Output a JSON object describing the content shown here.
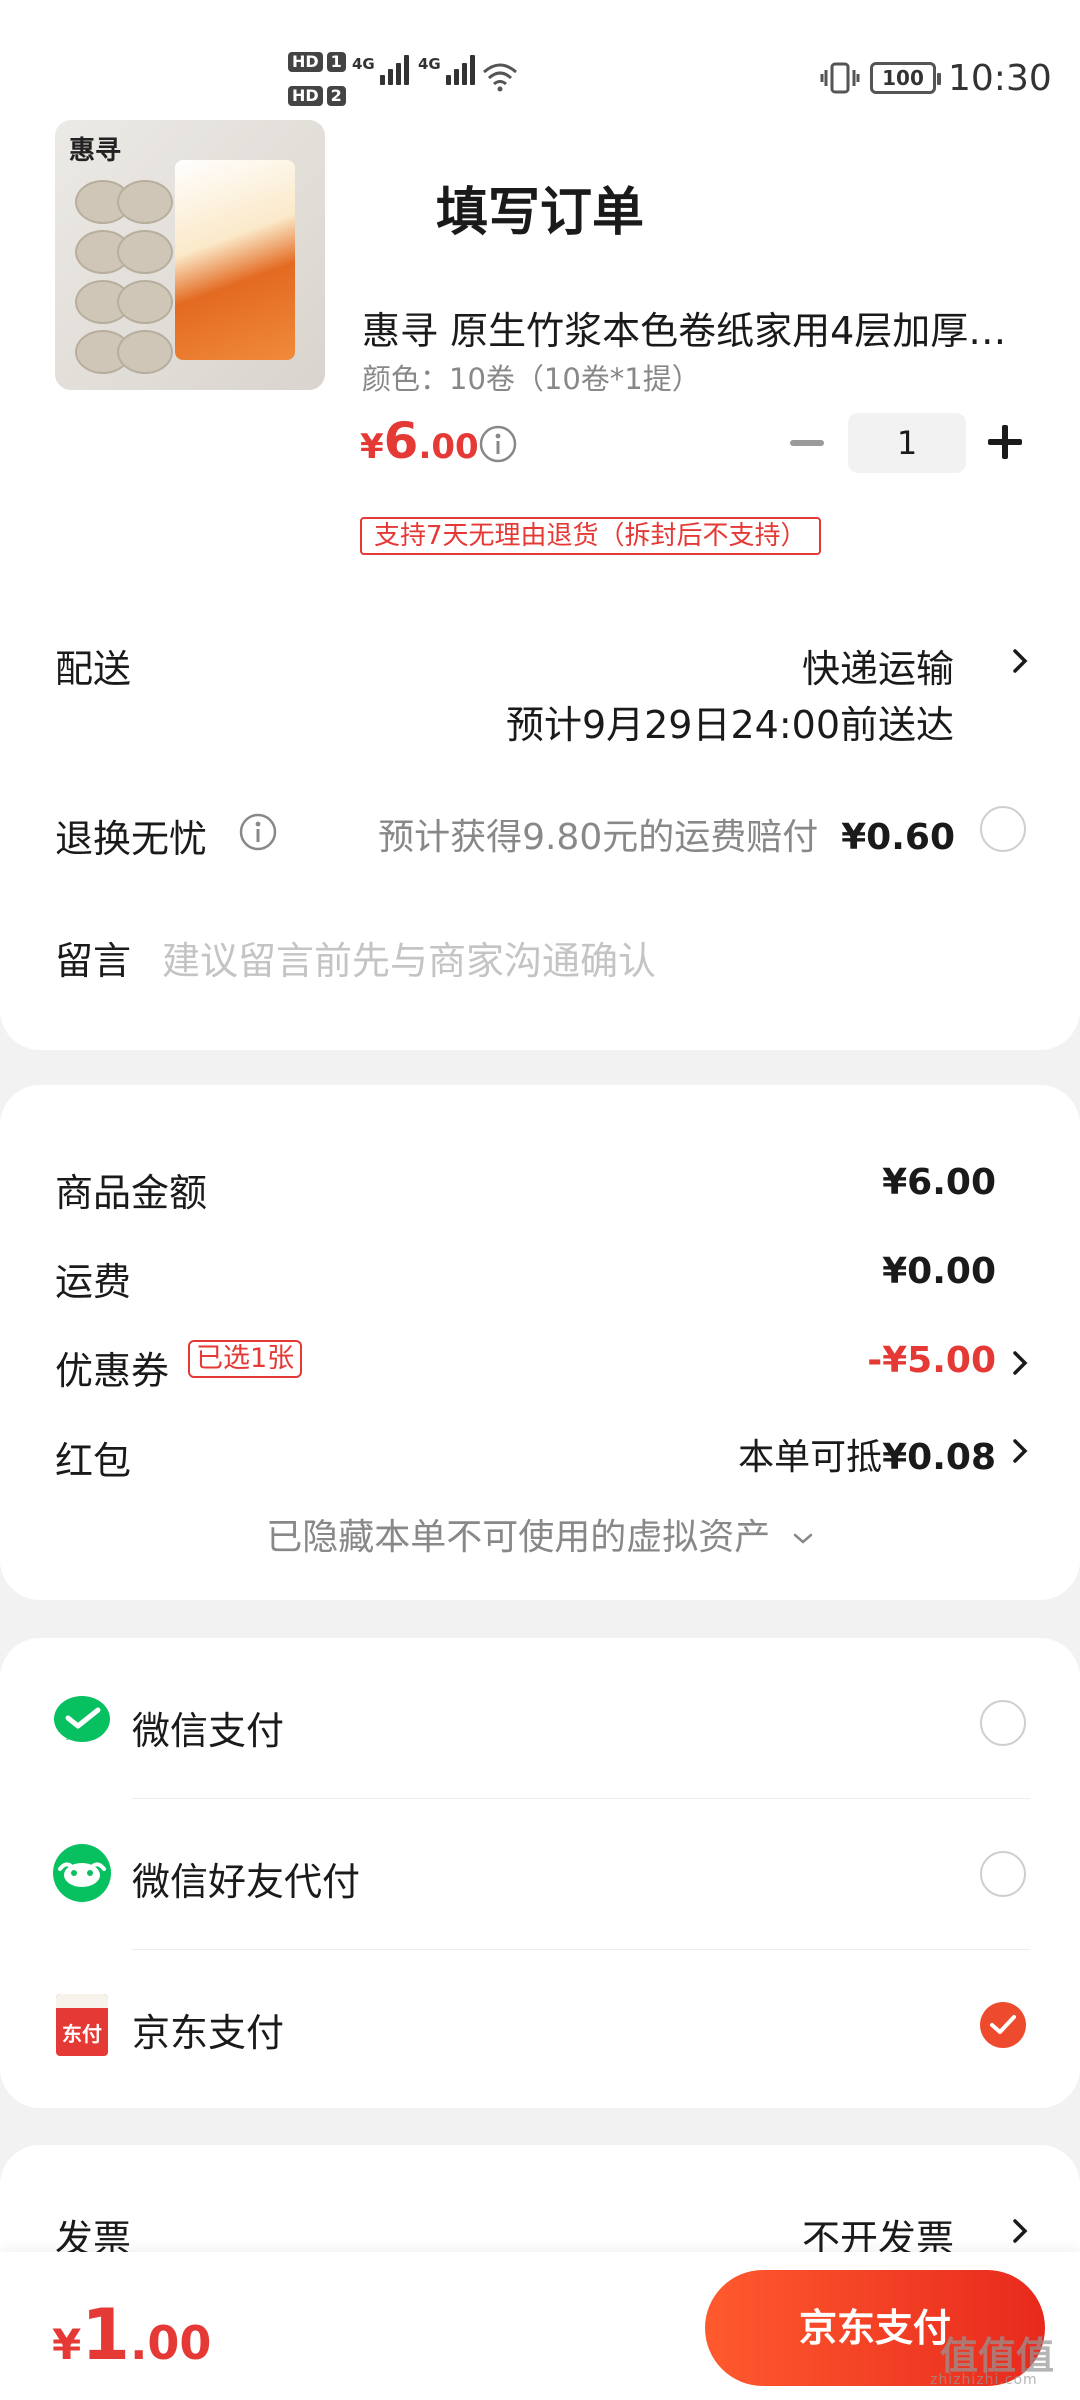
{
  "status_bar": {
    "hd1": "HD",
    "hd1_num": "1",
    "hd2": "HD",
    "hd2_num": "2",
    "net1": "4G",
    "net2": "4G",
    "battery": "100",
    "time": "10:30"
  },
  "nav": {
    "title": "填写订单",
    "back_icon": "back-chevron-icon"
  },
  "product": {
    "title": "惠寻 原生竹浆本色卷纸家用4层加厚…",
    "spec": "颜色：10卷（10卷*1提）",
    "price_currency": "¥",
    "price_int": "6",
    "price_dec": ".00",
    "quantity": "1",
    "return_policy": "支持7天无理由退货（拆封后不支持）",
    "thumb_brand": "惠寻"
  },
  "delivery": {
    "label": "配送",
    "method": "快递运输",
    "eta": "预计9月29日24:00前送达"
  },
  "return_insurance": {
    "label": "退换无忧",
    "desc": "预计获得9.80元的运费赔付",
    "price": "¥0.60",
    "checked": false
  },
  "remark": {
    "label": "留言",
    "placeholder": "建议留言前先与商家沟通确认"
  },
  "summary": {
    "goods_label": "商品金额",
    "goods_amount": "¥6.00",
    "freight_label": "运费",
    "freight_amount": "¥0.00",
    "coupon_label": "优惠券",
    "coupon_badge": "已选1张",
    "coupon_amount": "-¥5.00",
    "redpacket_label": "红包",
    "redpacket_prefix": "本单可抵",
    "redpacket_amount": "¥0.08",
    "hidden_assets": "已隐藏本单不可使用的虚拟资产"
  },
  "payment_methods": [
    {
      "label": "微信支付",
      "icon": "wechat-pay-icon",
      "selected": false
    },
    {
      "label": "微信好友代付",
      "icon": "wechat-friend-pay-icon",
      "selected": false
    },
    {
      "label": "京东支付",
      "icon": "jd-pay-icon",
      "icon_text": "东付",
      "selected": true
    }
  ],
  "invoice": {
    "label": "发票",
    "value": "不开发票"
  },
  "footer": {
    "total_currency": "¥",
    "total_int": "1",
    "total_dec": ".00",
    "pay_button": "京东支付"
  },
  "watermark": {
    "text": "值值值",
    "sub": "zhizhizhi.com"
  },
  "colors": {
    "accent": "#e53935",
    "button": "#ee4a2d",
    "wechat": "#07c160"
  }
}
